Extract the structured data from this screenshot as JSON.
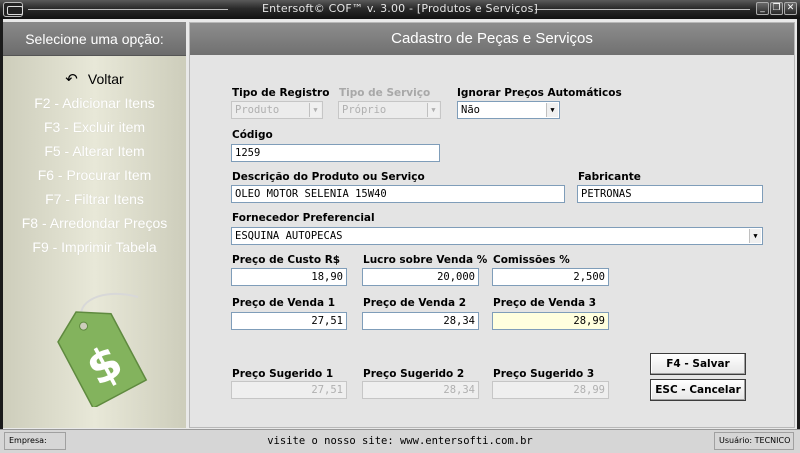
{
  "window": {
    "title": "Entersoft© COF™ v. 3.00 - [Produtos e Serviços]",
    "controls": [
      "minimize-icon",
      "restore-icon",
      "close-icon"
    ]
  },
  "sidebar": {
    "header": "Selecione uma opção:",
    "items": [
      {
        "label": "Voltar",
        "icon": "back-arrow-icon",
        "active": true
      },
      {
        "label": "F2 - Adicionar Itens",
        "active": false
      },
      {
        "label": "F3 - Excluir item",
        "active": false
      },
      {
        "label": "F5 - Alterar Item",
        "active": false
      },
      {
        "label": "F6 - Procurar Item",
        "active": false
      },
      {
        "label": "F7 - Filtrar Itens",
        "active": false
      },
      {
        "label": "F8 - Arredondar Preços",
        "active": false
      },
      {
        "label": "F9 - Imprimir Tabela",
        "active": false
      }
    ],
    "image": "dollar-price-tag-icon"
  },
  "form": {
    "title": "Cadastro de Peças e Serviços",
    "tipo_registro": {
      "label": "Tipo de Registro",
      "value": "Produto"
    },
    "tipo_servico": {
      "label": "Tipo de Serviço",
      "value": "Próprio"
    },
    "ignorar_precos": {
      "label": "Ignorar Preços Automáticos",
      "value": "Não"
    },
    "codigo": {
      "label": "Código",
      "value": "1259"
    },
    "descricao": {
      "label": "Descrição do Produto ou Serviço",
      "value": "OLEO MOTOR SELENIA 15W40"
    },
    "fabricante": {
      "label": "Fabricante",
      "value": "PETRONAS"
    },
    "fornecedor": {
      "label": "Fornecedor Preferencial",
      "value": "ESQUINA AUTOPECAS"
    },
    "preco_custo": {
      "label": "Preço de Custo R$",
      "value": "18,90"
    },
    "lucro": {
      "label": "Lucro sobre Venda  %",
      "value": "20,000"
    },
    "comissoes": {
      "label": "Comissões  %",
      "value": "2,500"
    },
    "preco_venda_1": {
      "label": "Preço de Venda 1",
      "value": "27,51"
    },
    "preco_venda_2": {
      "label": "Preço de Venda 2",
      "value": "28,34"
    },
    "preco_venda_3": {
      "label": "Preço de Venda 3",
      "value": "28,99"
    },
    "preco_sugerido_1": {
      "label": "Preço Sugerido 1",
      "value": "27,51"
    },
    "preco_sugerido_2": {
      "label": "Preço Sugerido 2",
      "value": "28,34"
    },
    "preco_sugerido_3": {
      "label": "Preço Sugerido 3",
      "value": "28,99"
    },
    "save_button": "F4 - Salvar",
    "cancel_button": "ESC - Cancelar"
  },
  "statusbar": {
    "empresa": "Empresa:",
    "site": "visite o nosso site: www.entersofti.com.br",
    "usuario": "Usuário: TECNICO"
  },
  "colors": {
    "header_gray": "#7a7a7a",
    "sidebar_bg": "#dcdccb",
    "highlight_field": "#ffffde",
    "tag_green": "#7fae5a"
  }
}
